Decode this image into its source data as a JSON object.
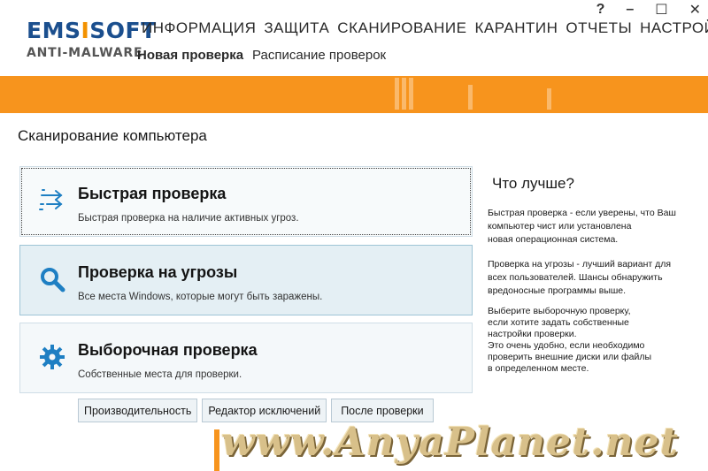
{
  "logo": {
    "brand_part1": "EMS",
    "brand_i": "I",
    "brand_part2": "SOFT",
    "product": "ANTI-MALWARE"
  },
  "window_controls": {
    "help": "?",
    "minimize": "–",
    "maximize": "☐",
    "close": "✕"
  },
  "top_nav": [
    "ИНФОРМАЦИЯ",
    "ЗАЩИТА",
    "СКАНИРОВАНИЕ",
    "КАРАНТИН",
    "ОТЧЕТЫ",
    "НАСТРОЙКИ"
  ],
  "sub_nav": {
    "active": "Новая проверка",
    "other": "Расписание проверок"
  },
  "section_title": "Сканирование компьютера",
  "cards": [
    {
      "title": "Быстрая проверка",
      "description": "Быстрая проверка на наличие активных угроз.",
      "icon": "quick-scan-arrows-icon"
    },
    {
      "title": "Проверка на угрозы",
      "description": "Все места Windows, которые могут быть заражены.",
      "icon": "magnifier-icon"
    },
    {
      "title": "Выборочная проверка",
      "description": "Собственные места для проверки.",
      "icon": "gear-icon"
    }
  ],
  "buttons": {
    "performance": "Производительность",
    "exclusions": "Редактор исключений",
    "after_scan": "После проверки"
  },
  "info": {
    "title": "Что лучше?",
    "p1": [
      "Быстрая проверка - если уверены, что Ваш",
      "компьютер   чист или установлена",
      "новая операционная система."
    ],
    "p2": [
      "Проверка на угрозы - лучший вариант для",
      "всех   пользователей. Шансы обнаружить",
      "вредоносные   программы выше."
    ],
    "p3": [
      "Выберите выборочную проверку,",
      "если хотите   задать собственные",
      "настройки проверки.",
      "Это очень удобно, если необходимо",
      "проверить   внешние диски или файлы",
      "в определенном месте."
    ]
  },
  "watermark": "www.AnyaPlanet.net",
  "colors": {
    "accent_orange": "#f7941d",
    "brand_blue": "#1b4f8e",
    "icon_blue": "#1e7fc3"
  }
}
